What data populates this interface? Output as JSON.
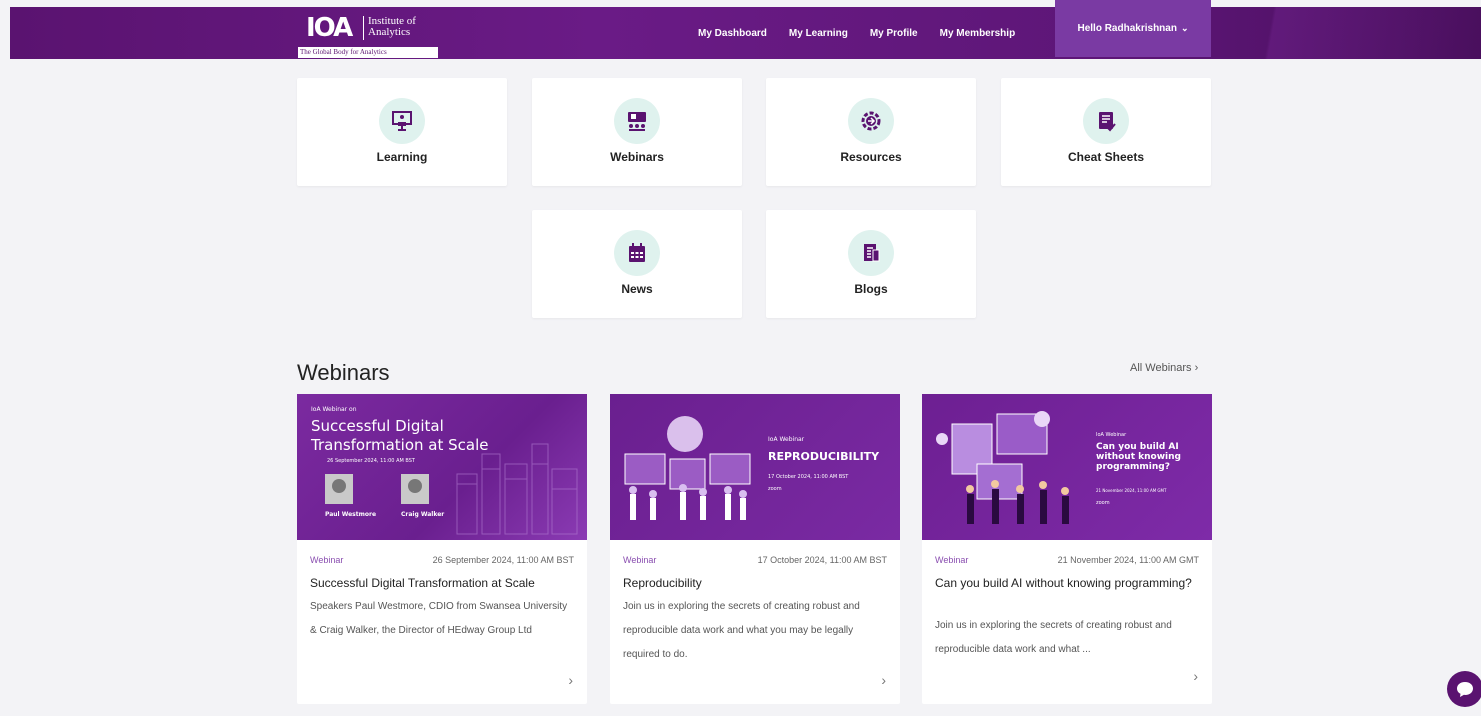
{
  "header": {
    "logo": {
      "mark": "IOA",
      "name_line1": "Institute of",
      "name_line2": "Analytics",
      "tagline": "The Global Body for Analytics"
    },
    "nav": [
      "My Dashboard",
      "My Learning",
      "My Profile",
      "My Membership"
    ],
    "user_menu": "Hello Radhakrishnan"
  },
  "tiles": [
    {
      "label": "Learning",
      "icon": "presentation-icon"
    },
    {
      "label": "Webinars",
      "icon": "webinar-icon"
    },
    {
      "label": "Resources",
      "icon": "resources-gear-icon"
    },
    {
      "label": "Cheat Sheets",
      "icon": "cheat-sheet-icon"
    },
    {
      "label": "News",
      "icon": "calendar-icon"
    },
    {
      "label": "Blogs",
      "icon": "blog-document-icon"
    }
  ],
  "webinars": {
    "title": "Webinars",
    "all_link": "All Webinars",
    "cards": [
      {
        "type": "Webinar",
        "date": "26 September 2024, 11:00 AM BST",
        "title": "Successful Digital Transformation at Scale",
        "description": "Speakers Paul Westmore, CDIO from Swansea University & Craig Walker, the Director of HEdway Group Ltd",
        "banner": {
          "kicker": "IoA Webinar on",
          "line1": "Successful Digital",
          "line2": "Transformation at Scale",
          "date": "26 September 2024, 11:00 AM BST",
          "speaker1": "Paul Westmore",
          "speaker2": "Craig Walker"
        }
      },
      {
        "type": "Webinar",
        "date": "17 October 2024, 11:00 AM BST",
        "title": "Reproducibility",
        "description": "Join us in exploring the secrets of creating robust and reproducible data work and what you may be legally required to do.",
        "banner": {
          "kicker": "IoA Webinar",
          "headline": "REPRODUCIBILITY",
          "date": "17 October 2024, 11:00 AM BST",
          "platform": "zoom"
        }
      },
      {
        "type": "Webinar",
        "date": "21 November 2024, 11:00 AM GMT",
        "title": "Can you build AI without knowing programming?",
        "description": "Join us in exploring the secrets of creating robust and reproducible data work and what ...",
        "banner": {
          "kicker": "IoA Webinar",
          "headline": "Can you build AI without knowing programming?",
          "date": "21 November 2024, 11:00 AM GMT",
          "platform": "zoom"
        }
      }
    ]
  },
  "colors": {
    "brand": "#5a1370",
    "accent": "#8a4fb0",
    "icon_bg": "#dff2ee"
  }
}
